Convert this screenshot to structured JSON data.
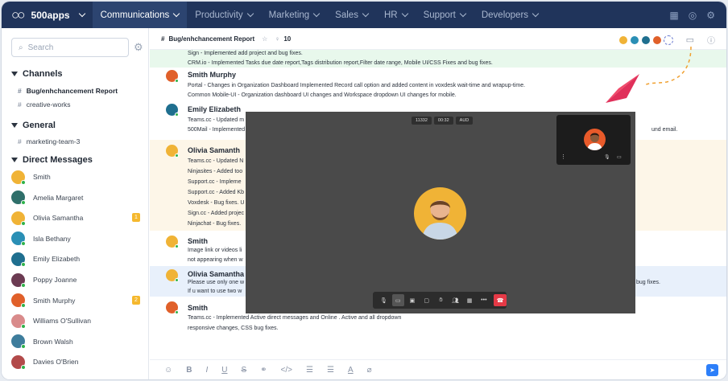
{
  "brand": {
    "name": "500apps"
  },
  "nav": [
    "Communications",
    "Productivity",
    "Marketing",
    "Sales",
    "HR",
    "Support",
    "Developers"
  ],
  "sidebar": {
    "search_placeholder": "Search",
    "sections": {
      "channels": "Channels",
      "general": "General",
      "dm": "Direct Messages"
    },
    "channels": [
      "Bug/enhchancement Report",
      "creative-works"
    ],
    "general": [
      "marketing-team-3"
    ],
    "dms": [
      {
        "name": "Smith",
        "badge": "",
        "color": "#f0b336"
      },
      {
        "name": "Amelia Margaret",
        "badge": "",
        "color": "#2f6f6a"
      },
      {
        "name": "Olivia Samantha",
        "badge": "1",
        "color": "#f0b336"
      },
      {
        "name": "Isla Bethany",
        "badge": "",
        "color": "#2a8fb5"
      },
      {
        "name": "Emily Elizabeth",
        "badge": "",
        "color": "#1f6f8f"
      },
      {
        "name": "Poppy Joanne",
        "badge": "",
        "color": "#6c3b52"
      },
      {
        "name": "Smith Murphy",
        "badge": "2",
        "color": "#e0602a"
      },
      {
        "name": "Williams O'Sullivan",
        "badge": "",
        "color": "#d98b8b"
      },
      {
        "name": "Brown Walsh",
        "badge": "",
        "color": "#3e7d9c"
      },
      {
        "name": "Davies O'Brien",
        "badge": "",
        "color": "#b24a4a"
      }
    ]
  },
  "channel_header": {
    "hash": "#",
    "title": "Bug/enhchancement Report",
    "star": "☆",
    "members": "10"
  },
  "messages": {
    "top_line1": "Sign - Implemented add project and bug fixes.",
    "top_line2": "CRM.io - Implemented Tasks due date report,Tags distribution report,Filter date range, Mobile UI/CSS Fixes and bug fixes.",
    "m1_name": "Smith Murphy",
    "m1_line1": "Portal - Changes in Organization Dashboard Implemented Record call option and added content in voxdesk wait-time and wrapup-time.",
    "m1_line2": "Common Mobile-UI - Organization dashboard UI changes and Workspace dropdown UI changes for mobile.",
    "m2_name": "Emily Elizabeth",
    "m2_line1": "Teams.cc - Updated m",
    "m2_line2": "500Mail - Implemented",
    "m2_tail": "und email.",
    "m3_name": "Olivia Samanth",
    "m3_lines": [
      "Teams.cc - Updated N",
      "Ninjasites - Added too",
      "Support.cc - Impleme",
      "Support.cc - Added Kb",
      "Voxdesk - Bug fixes. U",
      "Sign.cc - Added projec",
      "Ninjachat - Bug fixes."
    ],
    "m4_name": "Smith",
    "m4_line1": "Image link or videos li",
    "m4_line2": "not appearing when w",
    "m5_name": "Olivia Samantha",
    "m5_line1": "Please use only one w",
    "m5_line2": "If u want to use two w",
    "m5_tail": "bug fixes.",
    "m6_name": "Smith",
    "m6_line1": "Teams.cc - Implemented Active direct messages and Online . Active and all dropdown",
    "m6_line2": "responsive changes, CSS bug fixes."
  },
  "video": {
    "time1": "11332",
    "time2": "00:32",
    "tag": "AUD"
  },
  "colors": {
    "topbar": "#20345b",
    "highlight_green": "#e8f8ec",
    "highlight_yellow": "#fdf6e8",
    "highlight_blue": "#e8f0fb",
    "end_call": "#e53946",
    "accent": "#2d7ff9"
  }
}
